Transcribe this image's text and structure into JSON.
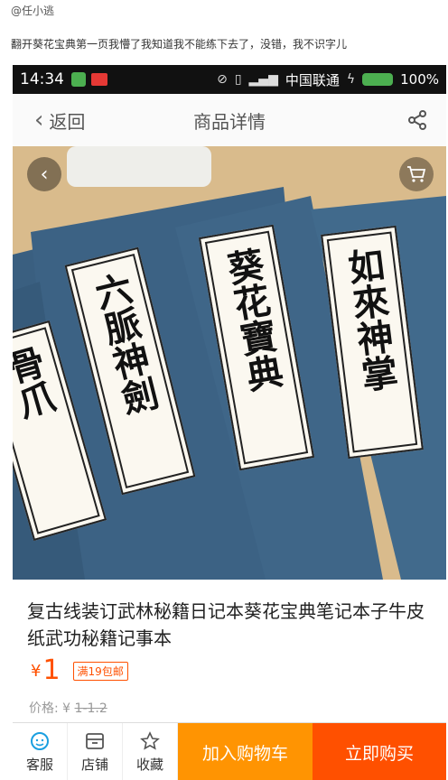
{
  "post": {
    "author": "@任小逃",
    "caption": "翻开葵花宝典第一页我懵了我知道我不能练下去了，没错，我不识字儿"
  },
  "status_bar": {
    "time": "14:34",
    "carrier": "中国联通",
    "battery": "100%"
  },
  "nav": {
    "back_label": "返回",
    "title": "商品详情"
  },
  "hero": {
    "books": [
      {
        "title": "骨爪"
      },
      {
        "title": "六脈神劍"
      },
      {
        "title": "葵花寶典"
      },
      {
        "title": "如來神掌"
      }
    ],
    "dots_total": 4,
    "active_dot": 1,
    "colors": {
      "cover": "#3c6284",
      "table": "#d7b888"
    }
  },
  "product": {
    "title": "复古线装订武林秘籍日记本葵花宝典笔记本子牛皮纸武功秘籍记事本",
    "price_symbol": "¥",
    "price": "1",
    "shipping_badge": "满19包邮",
    "original_price_label": "价格:",
    "original_price_symbol": "¥",
    "original_price": "1-1.2"
  },
  "bottom_bar": {
    "customer_service": "客服",
    "shop": "店铺",
    "favorite": "收藏",
    "add_to_cart": "加入购物车",
    "buy_now": "立即购买"
  },
  "colors": {
    "accent": "#ff5000",
    "cart_button": "#ff9402"
  }
}
